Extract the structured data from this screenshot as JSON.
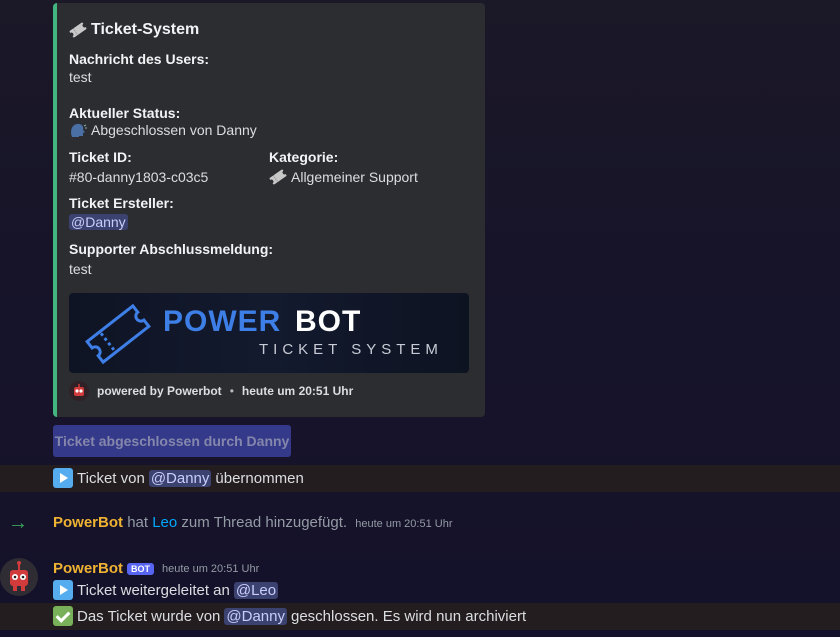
{
  "embed": {
    "title": "Ticket-System",
    "accent_color": "#43b581",
    "fields": {
      "message_name": "Nachricht des Users:",
      "message_value": "test",
      "status_name": "Aktueller Status:",
      "status_value": "Abgeschlossen von Danny",
      "ticket_id_name": "Ticket ID:",
      "ticket_id_value": "#80-danny1803-c03c5",
      "category_name": "Kategorie:",
      "category_value": "Allgemeiner Support",
      "creator_name": "Ticket Ersteller:",
      "creator_value": "@Danny",
      "closing_name": "Supporter Abschlussmeldung:",
      "closing_value": "test"
    },
    "banner": {
      "word1": "POWER",
      "word2": "BOT",
      "subtitle": "TICKET SYSTEM"
    },
    "footer": {
      "text": "powered by Powerbot",
      "separator": "•",
      "time": "heute um 20:51 Uhr"
    }
  },
  "button": {
    "label": "Ticket abgeschlossen durch Danny"
  },
  "messages": {
    "taken_over": {
      "prefix": "Ticket von",
      "mention": "@Danny",
      "suffix": "übernommen"
    },
    "system": {
      "bot": "PowerBot",
      "text1": "hat",
      "user": "Leo",
      "text2": "zum Thread hinzugefügt.",
      "time": "heute um 20:51 Uhr"
    },
    "author": {
      "name": "PowerBot",
      "badge": "BOT",
      "time": "heute um 20:51 Uhr",
      "name_color": "#f0b232"
    },
    "forwarded": {
      "prefix": "Ticket weitergeleitet an",
      "mention": "@Leo"
    },
    "closed": {
      "prefix": "Das Ticket wurde von",
      "mention": "@Danny",
      "suffix": "geschlossen. Es wird nun archiviert"
    }
  },
  "icons": [
    "ticket-icon",
    "speaking-head-icon",
    "play-button-icon",
    "check-mark-icon",
    "join-arrow-icon",
    "bot-avatar-icon"
  ]
}
